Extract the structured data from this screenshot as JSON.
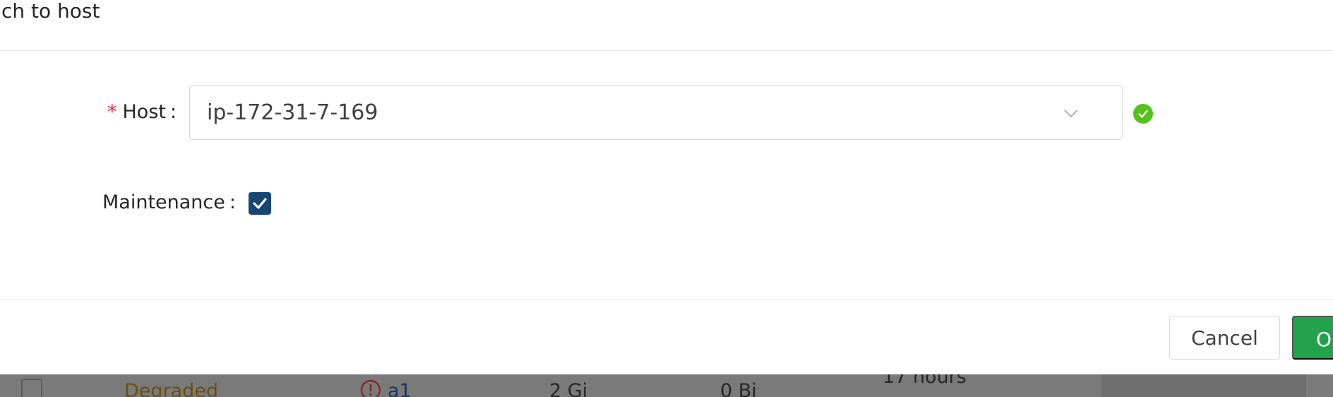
{
  "dialog": {
    "title": "ch to host",
    "host_field": {
      "required_mark": "*",
      "label": "Host",
      "colon": ":",
      "value": "ip-172-31-7-169",
      "valid": true
    },
    "maintenance_field": {
      "label": "Maintenance",
      "colon": ":",
      "checked": true
    },
    "footer": {
      "cancel_label": "Cancel",
      "ok_label": "O"
    }
  },
  "background_table": {
    "row": {
      "status": "Degraded",
      "name": "a1",
      "size": "2 Gi",
      "used": "0 Bi",
      "age": "17 hours"
    }
  },
  "colors": {
    "primary_button": "#23a24d",
    "checkbox_fill": "#164673",
    "valid_icon": "#52c41a",
    "required_mark": "#f5222d"
  }
}
